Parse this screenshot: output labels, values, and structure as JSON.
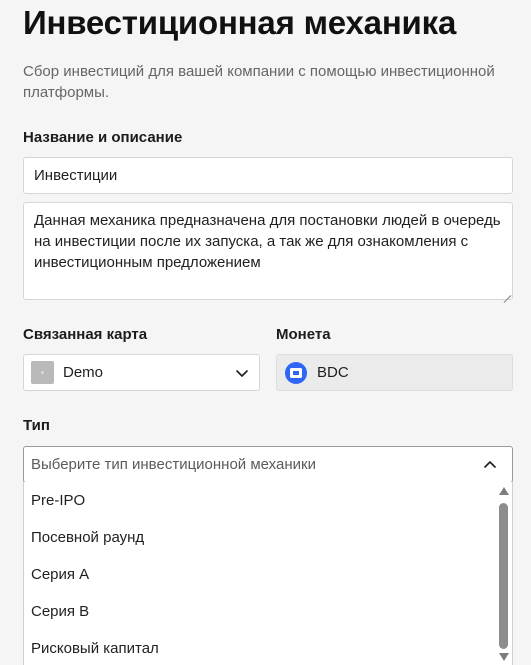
{
  "header": {
    "title": "Инвестиционная механика",
    "subtitle": "Сбор инвестиций для вашей компании с помощью инвестиционной платформы."
  },
  "name_section": {
    "label": "Название и описание",
    "name_value": "Инвестиции",
    "description_value": "Данная механика предназначена для постановки людей в очередь на инвестиции после их запуска, а так же для ознакомления с инвестиционным предложением"
  },
  "linked_map": {
    "label": "Связанная карта",
    "value": "Demo",
    "thumb_icon": "map-thumbnail-icon"
  },
  "coin": {
    "label": "Монета",
    "value": "BDC",
    "icon": "coin-logo-icon",
    "icon_color": "#2f66f6"
  },
  "type": {
    "label": "Тип",
    "placeholder": "Выберите тип инвестиционной механики",
    "options": [
      "Pre-IPO",
      "Посевной раунд",
      "Серия A",
      "Серия B",
      "Рисковый капитал"
    ]
  }
}
